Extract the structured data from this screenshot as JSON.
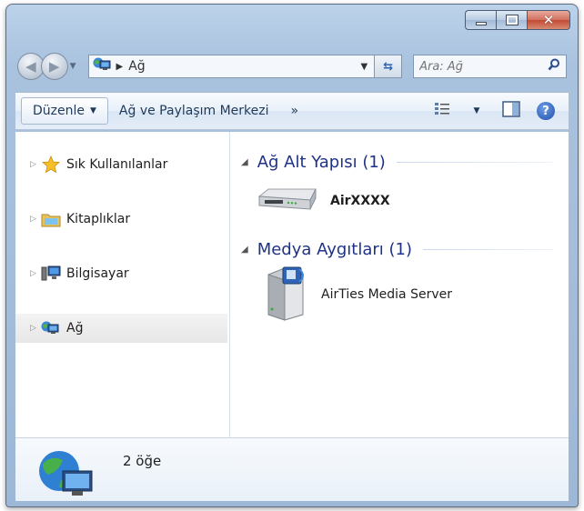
{
  "navigation": {
    "address_path": "Ağ",
    "search_placeholder": "Ara: Ağ"
  },
  "toolbar": {
    "organize_label": "Düzenle",
    "network_center_label": "Ağ ve Paylaşım Merkezi",
    "overflow_label": "»"
  },
  "sidebar": {
    "items": [
      {
        "label": "Sık Kullanılanlar",
        "icon": "star-icon"
      },
      {
        "label": "Kitaplıklar",
        "icon": "library-folder-icon"
      },
      {
        "label": "Bilgisayar",
        "icon": "computer-icon"
      },
      {
        "label": "Ağ",
        "icon": "network-icon",
        "selected": true
      }
    ]
  },
  "groups": [
    {
      "title": "Ağ Alt Yapısı (1)",
      "devices": [
        {
          "name": "AirXXXX",
          "icon": "router-icon"
        }
      ]
    },
    {
      "title": "Medya Aygıtları (1)",
      "devices": [
        {
          "name": "AirTies Media Server",
          "icon": "media-server-icon"
        }
      ]
    }
  ],
  "details": {
    "item_count": "2 öğe"
  }
}
